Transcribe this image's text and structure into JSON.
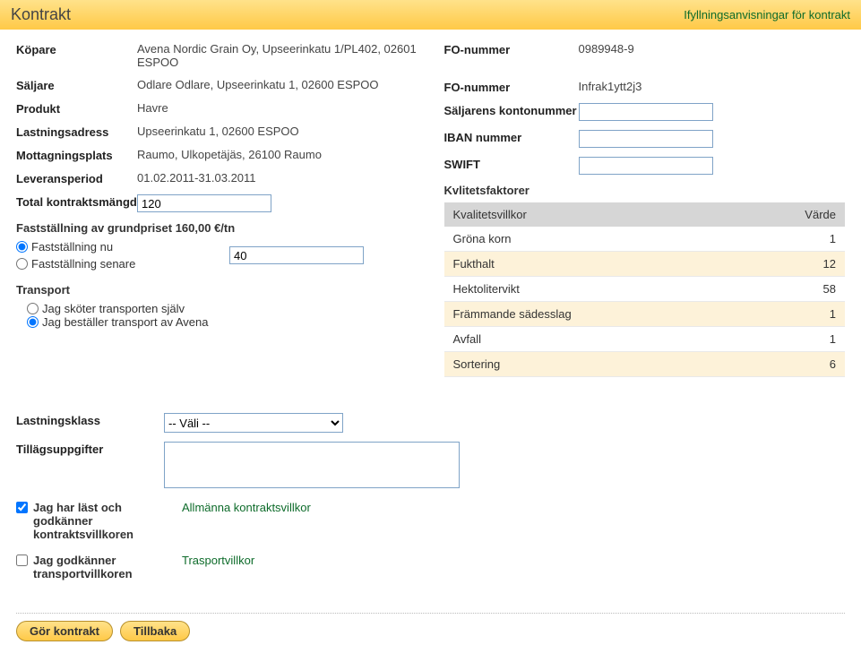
{
  "header": {
    "title": "Kontrakt",
    "instructions_link": "Ifyllningsanvisningar för kontrakt"
  },
  "left": {
    "buyer_label": "Köpare",
    "buyer_value": "Avena Nordic Grain Oy, Upseerinkatu 1/PL402, 02601 ESPOO",
    "seller_label": "Säljare",
    "seller_value": "Odlare Odlare, Upseerinkatu 1, 02600 ESPOO",
    "product_label": "Produkt",
    "product_value": "Havre",
    "loading_addr_label": "Lastningsadress",
    "loading_addr_value": "Upseerinkatu 1, 02600 ESPOO",
    "receiving_label": "Mottagningsplats",
    "receiving_value": "Raumo, Ulkopetäjäs, 26100 Raumo",
    "period_label": "Leveransperiod",
    "period_value": "01.02.2011-31.03.2011",
    "total_qty_label": "Total kontraktsmängd",
    "total_qty_value": "120",
    "price_section": "Fastställning av grundpriset 160,00 €/tn",
    "price_now": "Fastställning nu",
    "price_later": "Fastställning senare",
    "price_input": "40",
    "transport_title": "Transport",
    "transport_self": "Jag sköter transporten själv",
    "transport_order": "Jag beställer transport av Avena"
  },
  "right": {
    "fo_label": "FO-nummer",
    "fo_value_buyer": "0989948-9",
    "fo_value_seller": "Infrak1ytt2j3",
    "seller_account_label": "Säljarens kontonummer",
    "iban_label": "IBAN nummer",
    "swift_label": "SWIFT",
    "quality_header": "Kvlitetsfaktorer",
    "table": {
      "col1": "Kvalitetsvillkor",
      "col2": "Värde",
      "rows": [
        {
          "name": "Gröna korn",
          "val": "1"
        },
        {
          "name": "Fukthalt",
          "val": "12"
        },
        {
          "name": "Hektolitervikt",
          "val": "58"
        },
        {
          "name": "Främmande sädesslag",
          "val": "1"
        },
        {
          "name": "Avfall",
          "val": "1"
        },
        {
          "name": "Sortering",
          "val": "6"
        }
      ]
    }
  },
  "bottom": {
    "loadclass_label": "Lastningsklass",
    "loadclass_value": "-- Väli --",
    "extra_label": "Tillägsuppgifter",
    "agree_terms_label": "Jag har läst och godkänner kontraktsvillkoren",
    "general_terms_link": "Allmänna kontraktsvillkor",
    "agree_transport_label": "Jag godkänner transportvillkoren",
    "transport_terms_link": "Trasportvillkor"
  },
  "buttons": {
    "submit": "Gör kontrakt",
    "back": "Tillbaka"
  }
}
